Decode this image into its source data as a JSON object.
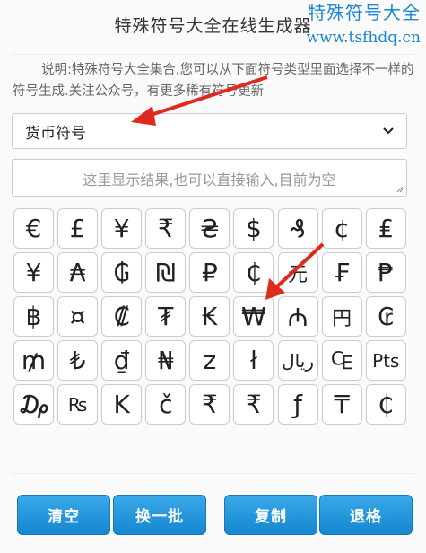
{
  "page": {
    "title": "特殊符号大全在线生成器",
    "watermark_line1": "特殊符号大全",
    "watermark_line2": "www.tsfhdq.cn",
    "description": "说明:特殊符号大全集合,您可以从下面符号类型里面选择不一样的符号生成.关注公众号，有更多稀有符号更新"
  },
  "category_select": {
    "value": "货币符号"
  },
  "result": {
    "placeholder": "这里显示结果,也可以直接输入,目前为空",
    "value": ""
  },
  "symbols": [
    "€",
    "£",
    "¥",
    "₹",
    "₴",
    "$",
    "₰",
    "¢",
    "₤",
    "¥",
    "₳",
    "₲",
    "₪",
    "₽",
    "₵",
    "元",
    "₣",
    "₱",
    "฿",
    "¤",
    "₡",
    "₮",
    "₭",
    "₩",
    "₼",
    "円",
    "₢",
    "₥",
    "₺",
    "₫",
    "₦",
    "z",
    "ł",
    "ريال",
    "₠",
    "Pts",
    "₯",
    "₨",
    "K",
    "č",
    "₹",
    "₹",
    "ƒ",
    "₸",
    "₵"
  ],
  "buttons": {
    "clear": "清空",
    "refresh": "换一批",
    "copy": "复制",
    "backspace": "退格"
  },
  "colors": {
    "accent": "#1a86d6",
    "button": "#1e90d8",
    "annotation_arrow": "#e02a1e"
  }
}
